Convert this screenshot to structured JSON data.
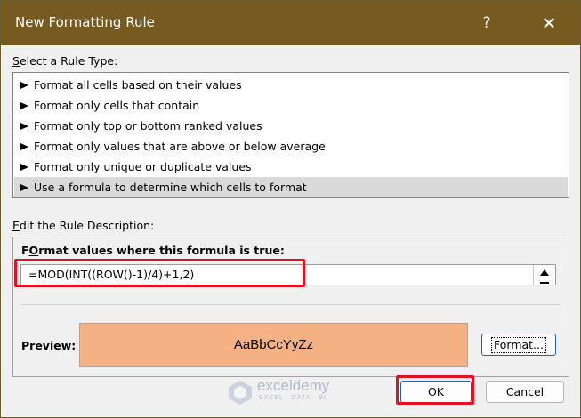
{
  "window": {
    "title": "New Formatting Rule",
    "help_glyph": "?",
    "close_glyph": "✕"
  },
  "rule_type": {
    "label_accel": "S",
    "label_rest": "elect a Rule Type:",
    "items": [
      {
        "label": "Format all cells based on their values",
        "selected": false
      },
      {
        "label": "Format only cells that contain",
        "selected": false
      },
      {
        "label": "Format only top or bottom ranked values",
        "selected": false
      },
      {
        "label": "Format only values that are above or below average",
        "selected": false
      },
      {
        "label": "Format only unique or duplicate values",
        "selected": false
      },
      {
        "label": "Use a formula to determine which cells to format",
        "selected": true
      }
    ]
  },
  "description": {
    "label_accel": "E",
    "label_rest": "dit the Rule Description:",
    "formula_label_accel": "O",
    "formula_label_pre": "F",
    "formula_label_rest": "rmat values where this formula is true:",
    "formula_value": "=MOD(INT((ROW()-1)/4)+1,2)"
  },
  "preview": {
    "label": "Preview:",
    "sample_text": "AaBbCcYyZz",
    "fill_color": "#f4b183",
    "format_button_accel": "F",
    "format_button_rest": "ormat..."
  },
  "buttons": {
    "ok": "OK",
    "cancel": "Cancel"
  },
  "watermark": {
    "name": "exceldemy",
    "tagline": "EXCEL · DATA · BI"
  },
  "colors": {
    "titlebar": "#765a1f",
    "highlight": "#e3101f",
    "accent_border": "#2a5fa5"
  }
}
